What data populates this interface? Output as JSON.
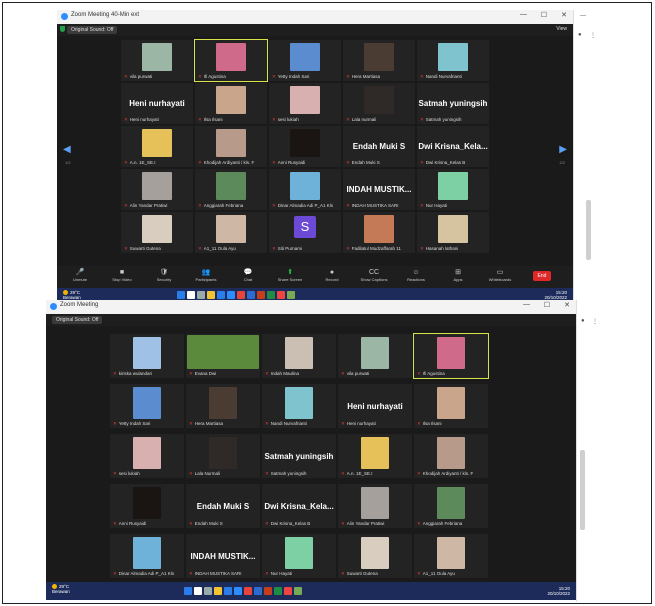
{
  "shot1": {
    "window_title": "Zoom Meeting 40-Min ext",
    "sound_chip": "Original Sound: Off",
    "view_label": "View",
    "page_left": "1/2",
    "page_right": "2/2",
    "tiles": [
      {
        "name": "vila purwati",
        "photo": "#9bb6a4"
      },
      {
        "name": "Ifi Agustina",
        "photo": "#d06a8a",
        "hl": true
      },
      {
        "name": "Yetty Indah Sari",
        "photo": "#5a8ccf"
      },
      {
        "name": "Hera Martiasa",
        "photo": "#4a3b33"
      },
      {
        "name": "Nandi Nurvafrianti",
        "photo": "#7fc3cf"
      },
      {
        "name": "Heni nurhayati",
        "big": "Heni nurhayati"
      },
      {
        "name": "Ilsa Ilsani",
        "photo": "#c9a58b"
      },
      {
        "name": "sesi lukiah",
        "photo": "#d9b0b0"
      },
      {
        "name": "Lala nurmali",
        "photo": "#2f2a28"
      },
      {
        "name": "Satmah yuningsih",
        "big": "Satmah yuningsih"
      },
      {
        "name": "A.n. 1E_SE.I",
        "photo": "#e6c15a"
      },
      {
        "name": "Khodijah Ardiyanti / kls. F",
        "photo": "#b79a8a"
      },
      {
        "name": "Anni Rusyaidi",
        "photo": "#1a1412"
      },
      {
        "name": "Endah Muki S",
        "big": "Endah Muki S"
      },
      {
        "name": "Dwi Krisna_Kelas B",
        "big": "Dwi Krisna_Kela..."
      },
      {
        "name": "Alin Yandar Pratiwi",
        "photo": "#a6a09c"
      },
      {
        "name": "Anggiarah Febriana",
        "photo": "#5c8a5a"
      },
      {
        "name": "Dinar Almadia Adi P_A1 Kls",
        "photo": "#6fb2d9"
      },
      {
        "name": "INDAH MUSTIKA SARI",
        "big": "INDAH MUSTIK..."
      },
      {
        "name": "Nur Hayati",
        "photo": "#7dcfa4"
      },
      {
        "name": "Suwarti Gutena",
        "photo": "#d8cdbf"
      },
      {
        "name": "A1_11 Oula Ayu",
        "photo": "#cfb7a6"
      },
      {
        "name": "Siti Purnami",
        "avatar": "S"
      },
      {
        "name": "Fadilatul Mudzaffarah 11",
        "photo": "#c47a56"
      },
      {
        "name": "Hasanah lathani",
        "photo": "#d6c4a0"
      }
    ],
    "toolbar": [
      {
        "label": "Unmute",
        "icon": "🎤"
      },
      {
        "label": "Stop Video",
        "icon": "■"
      },
      {
        "label": "Security",
        "icon": "🛡"
      },
      {
        "label": "Participants",
        "icon": "👥"
      },
      {
        "label": "Chat",
        "icon": "💬"
      },
      {
        "label": "Share Screen",
        "icon": "⬆",
        "green": true
      },
      {
        "label": "Record",
        "icon": "●"
      },
      {
        "label": "Show Captions",
        "icon": "CC"
      },
      {
        "label": "Reactions",
        "icon": "☺"
      },
      {
        "label": "Apps",
        "icon": "⊞"
      },
      {
        "label": "Whiteboards",
        "icon": "▭"
      }
    ],
    "end_label": "End",
    "weather_temp": "29°C",
    "weather_desc": "Berawan",
    "clock_time": "15:20",
    "clock_date": "20/10/2022"
  },
  "shot2": {
    "window_title": "Zoom Meeting",
    "sound_chip": "Original Sound: Off",
    "tiles": [
      {
        "name": "kiriska wulandari",
        "photo": "#9fc1e6"
      },
      {
        "name": "Evana Dwi",
        "photo": "#5b8a3c",
        "wide": true
      },
      {
        "name": "Indah Maulina",
        "photo": "#cabfb2"
      },
      {
        "name": "vila purwati",
        "photo": "#9bb6a4"
      },
      {
        "name": "Ifi Agustina",
        "photo": "#d06a8a",
        "hl": true
      },
      {
        "name": "Yetty Indah Sari",
        "photo": "#5a8ccf"
      },
      {
        "name": "Hera Martiasa",
        "photo": "#4a3b33"
      },
      {
        "name": "Nandi Nurvafrianti",
        "photo": "#7fc3cf"
      },
      {
        "name": "Heni nurhayati",
        "big": "Heni nurhayati"
      },
      {
        "name": "Ilsa Ilsani",
        "photo": "#c9a58b"
      },
      {
        "name": "sesi lukiah",
        "photo": "#d9b0b0"
      },
      {
        "name": "Lala Nurmali",
        "photo": "#2f2a28"
      },
      {
        "name": "Satmah yuningsih",
        "big": "Satmah yuningsih"
      },
      {
        "name": "A.n. 1E_SE.I",
        "photo": "#e6c15a"
      },
      {
        "name": "Khodijah Ardiyanti / kls. F",
        "photo": "#b79a8a"
      },
      {
        "name": "Anni Rusyaidi",
        "photo": "#1a1412"
      },
      {
        "name": "Endah Muki S",
        "big": "Endah Muki S"
      },
      {
        "name": "Dwi Krisna_Kelas B",
        "big": "Dwi Krisna_Kela..."
      },
      {
        "name": "Alin Yandar Pratiwi",
        "photo": "#a6a09c"
      },
      {
        "name": "Anggiarah Febriana",
        "photo": "#5c8a5a"
      },
      {
        "name": "Dinar Almadia Adi P_A1 Kls",
        "photo": "#6fb2d9"
      },
      {
        "name": "INDAH MUSTIKA SARI",
        "big": "INDAH MUSTIK..."
      },
      {
        "name": "Nur Hayati",
        "photo": "#7dcfa4"
      },
      {
        "name": "Suwarti Gutena",
        "photo": "#d8cdbf"
      },
      {
        "name": "A1_11 Oula Ayu",
        "photo": "#cfb7a6"
      }
    ],
    "weather_temp": "29°C",
    "weather_desc": "Berawan",
    "clock_time": "15:20",
    "clock_date": "20/10/2022"
  }
}
